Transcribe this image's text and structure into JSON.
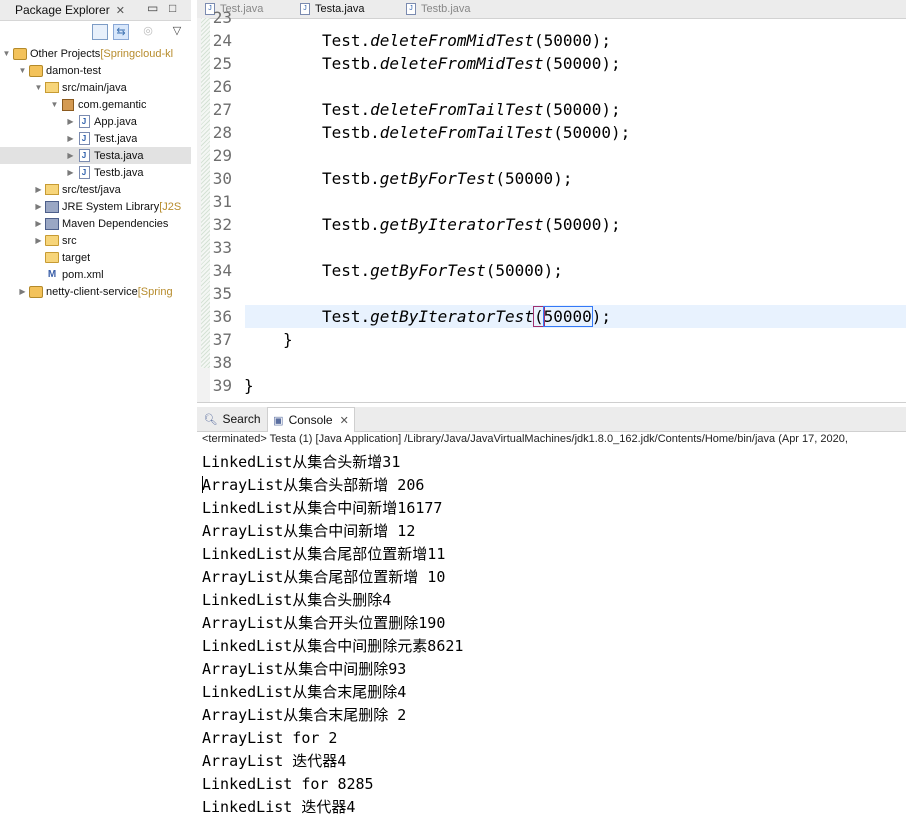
{
  "package_explorer": {
    "title": "Package Explorer",
    "tree": [
      {
        "label": "Other Projects",
        "decoration": " [Springcloud-kl",
        "indent": 0,
        "expanded": true,
        "icon": "working-set-icon"
      },
      {
        "label": "damon-test",
        "decoration": "",
        "indent": 1,
        "expanded": true,
        "icon": "maven-project-icon"
      },
      {
        "label": "src/main/java",
        "decoration": "",
        "indent": 2,
        "expanded": true,
        "icon": "source-folder-icon"
      },
      {
        "label": "com.gemantic",
        "decoration": "",
        "indent": 3,
        "expanded": true,
        "icon": "package-icon"
      },
      {
        "label": "App.java",
        "decoration": "",
        "indent": 4,
        "expanded": false,
        "icon": "java-file-icon"
      },
      {
        "label": "Test.java",
        "decoration": "",
        "indent": 4,
        "expanded": false,
        "icon": "java-file-icon"
      },
      {
        "label": "Testa.java",
        "decoration": "",
        "indent": 4,
        "expanded": false,
        "icon": "java-file-icon",
        "selected": true
      },
      {
        "label": "Testb.java",
        "decoration": "",
        "indent": 4,
        "expanded": false,
        "icon": "java-file-icon"
      },
      {
        "label": "src/test/java",
        "decoration": "",
        "indent": 2,
        "expanded": false,
        "icon": "source-folder-icon"
      },
      {
        "label": "JRE System Library",
        "decoration": " [J2S",
        "indent": 2,
        "expanded": false,
        "icon": "library-icon"
      },
      {
        "label": "Maven Dependencies",
        "decoration": "",
        "indent": 2,
        "expanded": false,
        "icon": "library-icon"
      },
      {
        "label": "src",
        "decoration": "",
        "indent": 2,
        "expanded": false,
        "icon": "folder-icon"
      },
      {
        "label": "target",
        "decoration": "",
        "indent": 2,
        "expanded": null,
        "icon": "folder-icon"
      },
      {
        "label": "pom.xml",
        "decoration": "",
        "indent": 2,
        "expanded": null,
        "icon": "xml-file-icon"
      },
      {
        "label": "netty-client-service",
        "decoration": " [Spring",
        "indent": 1,
        "expanded": false,
        "icon": "maven-project-icon"
      }
    ]
  },
  "editor": {
    "tabs": [
      {
        "label": "Test.java",
        "active": false
      },
      {
        "label": "Testa.java",
        "active": true
      },
      {
        "label": "Testb.java",
        "active": false
      }
    ],
    "lines": [
      {
        "num": "23",
        "cls": "",
        "parts": [
          {
            "t": "",
            "c": ""
          }
        ]
      },
      {
        "num": "24",
        "cls": "",
        "parts": [
          {
            "t": "Test.",
            "c": ""
          },
          {
            "t": "deleteFromMidTest",
            "c": "mth"
          },
          {
            "t": "(50000);",
            "c": ""
          }
        ]
      },
      {
        "num": "25",
        "cls": "",
        "parts": [
          {
            "t": "Testb.",
            "c": ""
          },
          {
            "t": "deleteFromMidTest",
            "c": "mth"
          },
          {
            "t": "(50000);",
            "c": ""
          }
        ]
      },
      {
        "num": "26",
        "cls": "",
        "parts": [
          {
            "t": "",
            "c": ""
          }
        ]
      },
      {
        "num": "27",
        "cls": "",
        "parts": [
          {
            "t": "Test.",
            "c": ""
          },
          {
            "t": "deleteFromTailTest",
            "c": "mth"
          },
          {
            "t": "(50000);",
            "c": ""
          }
        ]
      },
      {
        "num": "28",
        "cls": "",
        "parts": [
          {
            "t": "Testb.",
            "c": ""
          },
          {
            "t": "deleteFromTailTest",
            "c": "mth"
          },
          {
            "t": "(50000);",
            "c": ""
          }
        ]
      },
      {
        "num": "29",
        "cls": "",
        "parts": [
          {
            "t": "",
            "c": ""
          }
        ]
      },
      {
        "num": "30",
        "cls": "",
        "parts": [
          {
            "t": "Testb.",
            "c": ""
          },
          {
            "t": "getByForTest",
            "c": "mth"
          },
          {
            "t": "(50000);",
            "c": ""
          }
        ]
      },
      {
        "num": "31",
        "cls": "",
        "parts": [
          {
            "t": "",
            "c": ""
          }
        ]
      },
      {
        "num": "32",
        "cls": "",
        "parts": [
          {
            "t": "Testb.",
            "c": ""
          },
          {
            "t": "getByIteratorTest",
            "c": "mth"
          },
          {
            "t": "(50000);",
            "c": ""
          }
        ]
      },
      {
        "num": "33",
        "cls": "",
        "parts": [
          {
            "t": "",
            "c": ""
          }
        ]
      },
      {
        "num": "34",
        "cls": "",
        "parts": [
          {
            "t": "Test.",
            "c": ""
          },
          {
            "t": "getByForTest",
            "c": "mth"
          },
          {
            "t": "(50000);",
            "c": ""
          }
        ]
      },
      {
        "num": "35",
        "cls": "",
        "parts": [
          {
            "t": "",
            "c": ""
          }
        ]
      },
      {
        "num": "36",
        "cls": "current",
        "parts": [
          {
            "t": "Test.",
            "c": ""
          },
          {
            "t": "getByIteratorTest",
            "c": "mth"
          },
          {
            "t": "(",
            "c": "bracket"
          },
          {
            "t": "50000",
            "c": "hl"
          },
          {
            "t": ");",
            "c": ""
          }
        ]
      },
      {
        "num": "37",
        "cls": "indent1",
        "parts": [
          {
            "t": "}",
            "c": ""
          }
        ]
      },
      {
        "num": "38",
        "cls": "",
        "parts": [
          {
            "t": "",
            "c": ""
          }
        ]
      },
      {
        "num": "39",
        "cls": "indent0",
        "parts": [
          {
            "t": "}",
            "c": ""
          }
        ]
      }
    ]
  },
  "console": {
    "tabs": [
      {
        "label": "Search",
        "active": false
      },
      {
        "label": "Console",
        "active": true
      }
    ],
    "terminated": "<terminated> Testa (1) [Java Application] /Library/Java/JavaVirtualMachines/jdk1.8.0_162.jdk/Contents/Home/bin/java (Apr 17, 2020,",
    "output": [
      "LinkedList从集合头新增31",
      "ArrayList从集合头部新增 206",
      "LinkedList从集合中间新增16177",
      "ArrayList从集合中间新增 12",
      "LinkedList从集合尾部位置新增11",
      "ArrayList从集合尾部位置新增 10",
      "LinkedList从集合头删除4",
      "ArrayList从集合开头位置删除190",
      "LinkedList从集合中间删除元素8621",
      "ArrayList从集合中间删除93",
      "LinkedList从集合末尾删除4",
      "ArrayList从集合末尾删除 2",
      "ArrayList for 2",
      "ArrayList 迭代器4",
      "LinkedList for 8285",
      "LinkedList 迭代器4"
    ]
  }
}
